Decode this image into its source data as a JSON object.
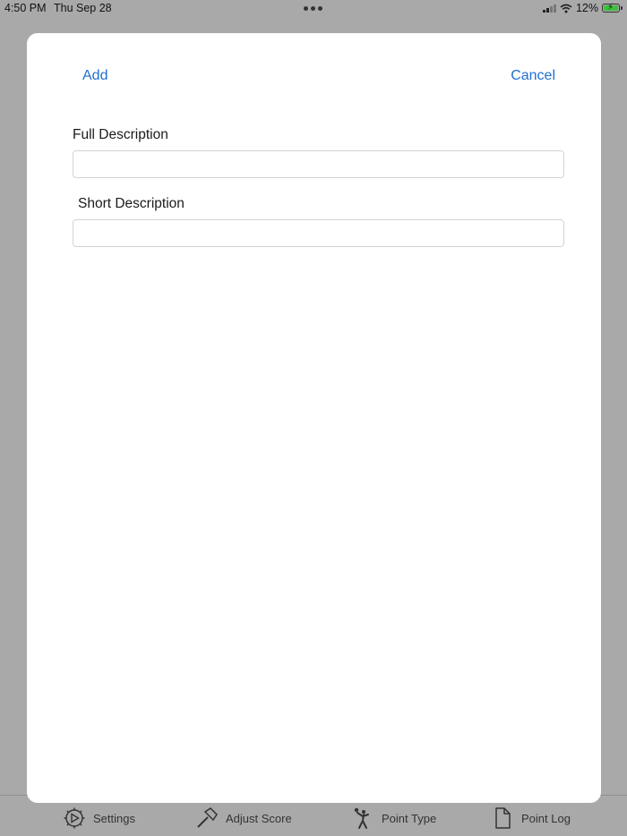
{
  "status_bar": {
    "time": "4:50 PM",
    "date": "Thu Sep 28",
    "battery_percent": "12%"
  },
  "modal": {
    "add_label": "Add",
    "cancel_label": "Cancel",
    "full_description": {
      "label": "Full Description",
      "value": "",
      "placeholder": ""
    },
    "short_description": {
      "label": "Short Description",
      "value": "",
      "placeholder": ""
    }
  },
  "tab_bar": {
    "items": [
      {
        "label": "Settings",
        "icon": "gear-icon"
      },
      {
        "label": "Adjust Score",
        "icon": "hammer-icon"
      },
      {
        "label": "Point Type",
        "icon": "volleyball-player-icon"
      },
      {
        "label": "Point Log",
        "icon": "document-icon"
      }
    ]
  },
  "colors": {
    "accent": "#1f6fcf",
    "backdrop": "#a9a9a9",
    "modal_background": "#ffffff",
    "battery_fill": "#3fbf3f"
  }
}
